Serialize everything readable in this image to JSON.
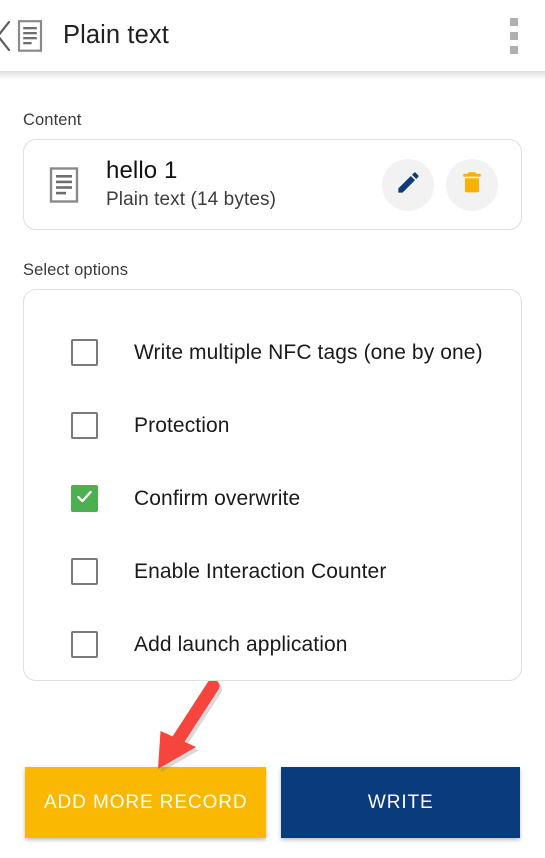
{
  "appbar": {
    "back_icon": "chevron-left-icon",
    "type_icon": "document-icon",
    "title": "Plain text",
    "overflow_icon": "more-vertical-icon"
  },
  "content_section": {
    "label": "Content",
    "record": {
      "icon": "document-icon",
      "title": "hello 1",
      "subtitle": "Plain text (14 bytes)",
      "edit_icon": "pencil-icon",
      "delete_icon": "trash-icon"
    }
  },
  "options_section": {
    "label": "Select options",
    "options": [
      {
        "label": "Write multiple NFC tags (one by one)",
        "checked": false
      },
      {
        "label": "Protection",
        "checked": false
      },
      {
        "label": "Confirm overwrite",
        "checked": true
      },
      {
        "label": "Enable Interaction Counter",
        "checked": false
      },
      {
        "label": "Add launch application",
        "checked": false
      }
    ]
  },
  "bottom_bar": {
    "add_more_label": "ADD MORE RECORD",
    "write_label": "WRITE"
  },
  "annotation": {
    "arrow_icon": "red-arrow-pointing-down-left"
  },
  "colors": {
    "accent_amber": "#fbb803",
    "accent_navy": "#0a3c7d",
    "checked_green": "#4caf50",
    "annotation_red": "#f6453d",
    "card_border": "#dfdfdf",
    "icon_gray": "#7a7a7a"
  }
}
